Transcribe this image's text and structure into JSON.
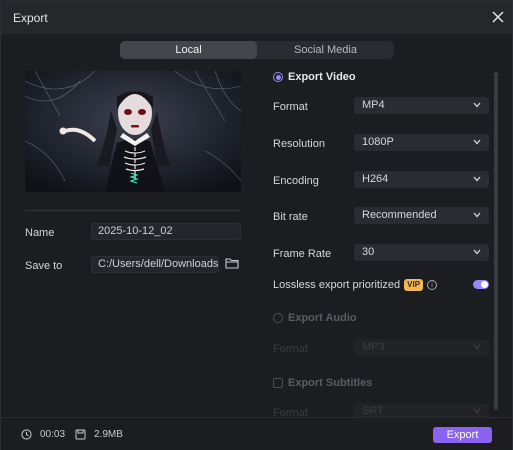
{
  "window": {
    "title": "Export"
  },
  "tabs": [
    {
      "label": "Local",
      "active": true
    },
    {
      "label": "Social Media",
      "active": false
    }
  ],
  "left": {
    "name_label": "Name",
    "name_value": "2025-10-12_02",
    "save_label": "Save to",
    "save_value": "C:/Users/dell/Downloads"
  },
  "export_video": {
    "label": "Export Video",
    "format": {
      "label": "Format",
      "value": "MP4"
    },
    "resolution": {
      "label": "Resolution",
      "value": "1080P"
    },
    "encoding": {
      "label": "Encoding",
      "value": "H264"
    },
    "bitrate": {
      "label": "Bit rate",
      "value": "Recommended"
    },
    "framerate": {
      "label": "Frame Rate",
      "value": "30"
    },
    "lossless": {
      "label": "Lossless export prioritized",
      "badge": "VIP",
      "enabled": true
    }
  },
  "export_audio": {
    "label": "Export Audio",
    "format_label": "Format",
    "format_value": "MP3"
  },
  "export_subtitles": {
    "label": "Export Subtitles",
    "format_label": "Format",
    "format_value": "SRT"
  },
  "footer": {
    "duration": "00:03",
    "size": "2.9MB",
    "export_label": "Export"
  },
  "colors": {
    "accent": "#8a63f0",
    "vip": "#f1b85a"
  }
}
